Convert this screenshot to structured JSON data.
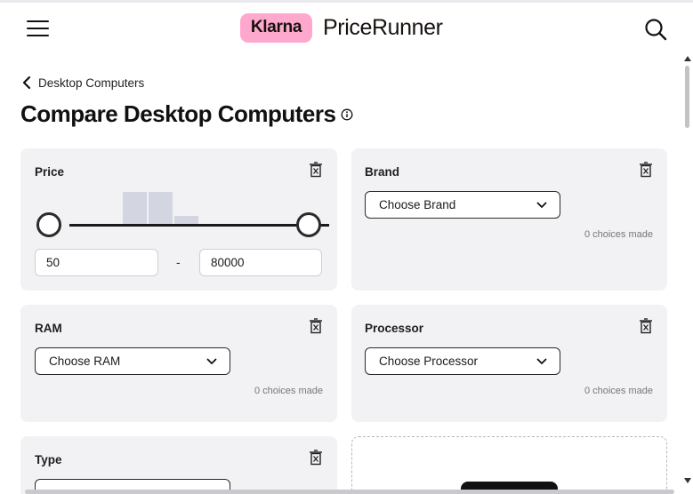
{
  "header": {
    "logo_badge": "Klarna",
    "logo_text": "PriceRunner",
    "menu_icon": "hamburger-menu-icon",
    "search_icon": "search-icon"
  },
  "breadcrumb": {
    "label": "Desktop Computers",
    "icon": "chevron-left-icon"
  },
  "page": {
    "title": "Compare Desktop Computers",
    "info_icon": "info-icon"
  },
  "filters": {
    "price": {
      "title": "Price",
      "min_value": "50",
      "max_value": "80000",
      "separator": "-",
      "histogram": [
        0,
        0.05,
        0.95,
        0.95,
        0.28,
        0.05,
        0.05,
        0.05,
        0,
        0.05
      ]
    },
    "brand": {
      "title": "Brand",
      "dropdown_label": "Choose Brand",
      "choices_text": "0 choices made"
    },
    "ram": {
      "title": "RAM",
      "dropdown_label": "Choose RAM",
      "choices_text": "0 choices made"
    },
    "processor": {
      "title": "Processor",
      "dropdown_label": "Choose Processor",
      "choices_text": "0 choices made"
    },
    "type": {
      "title": "Type"
    }
  },
  "colors": {
    "card_bg": "#f2f2f5",
    "klarna_pink": "#ffa8cd",
    "histogram_bar": "#d3d6e0",
    "text_dark": "#111111"
  }
}
